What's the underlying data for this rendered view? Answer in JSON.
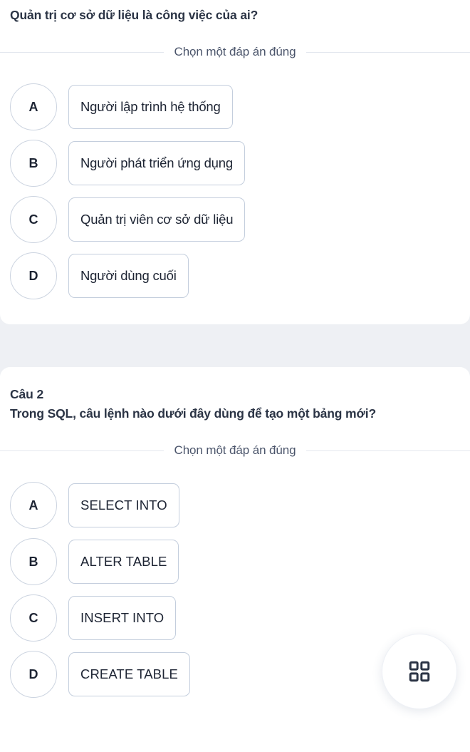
{
  "quiz": {
    "choose_label": "Chọn một đáp án đúng",
    "questions": [
      {
        "number": "",
        "text": "Quản trị cơ sở dữ liệu là công việc của ai?",
        "options": [
          {
            "letter": "A",
            "text": "Người lập trình hệ thống"
          },
          {
            "letter": "B",
            "text": "Người phát triển ứng dụng"
          },
          {
            "letter": "C",
            "text": "Quản trị viên cơ sở dữ liệu"
          },
          {
            "letter": "D",
            "text": "Người dùng cuối"
          }
        ]
      },
      {
        "number": "Câu 2",
        "text": "Trong SQL, câu lệnh nào dưới đây dùng để tạo một bảng mới?",
        "options": [
          {
            "letter": "A",
            "text": "SELECT INTO"
          },
          {
            "letter": "B",
            "text": "ALTER TABLE"
          },
          {
            "letter": "C",
            "text": "INSERT INTO"
          },
          {
            "letter": "D",
            "text": "CREATE TABLE"
          }
        ]
      }
    ]
  },
  "fab": {
    "icon": "grid-2x2-icon"
  },
  "colors": {
    "page_background": "#eef0f4",
    "card_background": "#ffffff",
    "text_primary": "#1d2433",
    "text_heading": "#2b3445",
    "text_muted": "#4b556b",
    "border": "#c4cedd",
    "rule": "#e3e7ee"
  }
}
